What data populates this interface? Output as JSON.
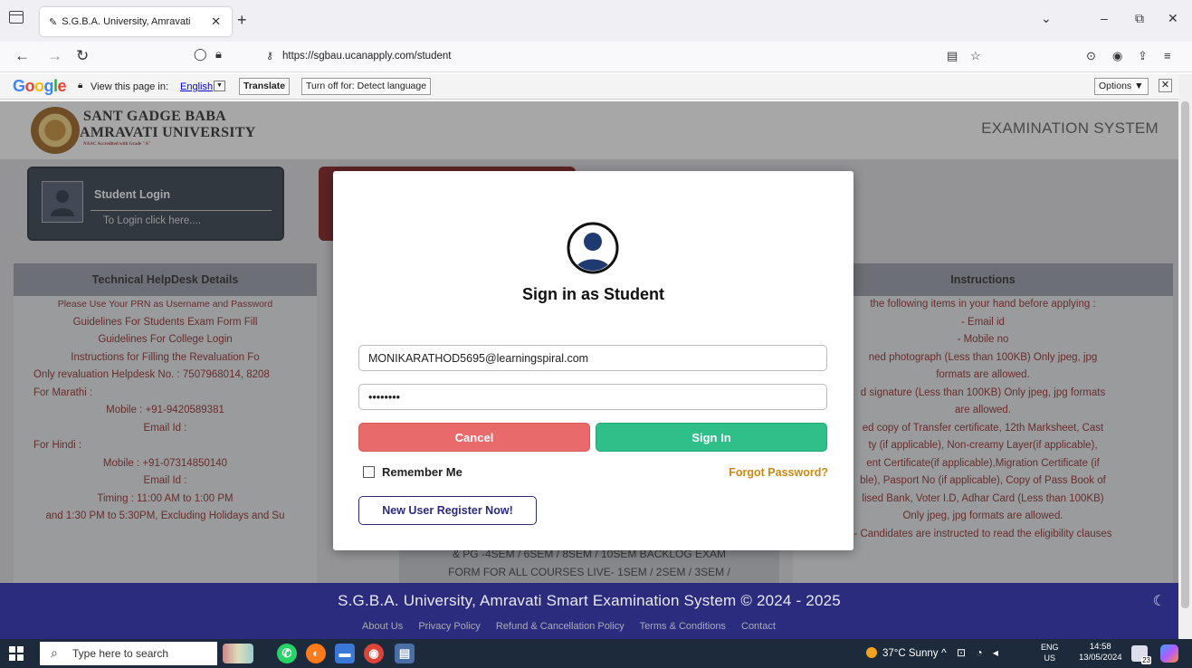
{
  "browser": {
    "tab_title": "S.G.B.A. University, Amravati",
    "url": "https://sgbau.ucanapply.com/student"
  },
  "translate_bar": {
    "google": "Google",
    "view_text": "View this page in:",
    "language": "English",
    "translate_button": "Translate",
    "turn_off_button": "Turn off for: Detect language",
    "options_button": "Options ▼"
  },
  "header": {
    "uni_line1": "SANT GADGE BABA",
    "uni_line2": "AMRAVATI UNIVERSITY",
    "uni_line3": "NAAC Accredited with Grade \"A\"",
    "system_title": "EXAMINATION SYSTEM"
  },
  "student_login": {
    "title": "Student Login",
    "subtitle": "To Login click here...."
  },
  "helpdesk": {
    "heading": "Technical HelpDesk Details",
    "lines": [
      "Please Use Your PRN as Username and Password",
      "Guidelines For Students Exam Form Fill",
      "Guidelines For College Login",
      "Instructions for Filling the Revaluation Fo",
      "Only revaluation Helpdesk No. : 7507968014, 8208",
      "For Marathi :",
      "Mobile : +91-9420589381",
      "Email Id :",
      "For Hindi :",
      "Mobile : +91-07314850140",
      "Email Id :",
      "Timing : 11:00 AM to 1:00 PM",
      "and 1:30 PM to 5:30PM, Excluding Holidays and Su"
    ]
  },
  "instructions": {
    "heading": "Instructions",
    "lines": [
      "the following items in your hand before applying :",
      "- Email id",
      "- Mobile no",
      "ned photograph (Less than 100KB) Only jpeg, jpg",
      "formats are allowed.",
      "d signature (Less than 100KB) Only jpeg, jpg formats",
      "are allowed.",
      "ed copy of Transfer certificate, 12th Marksheet, Cast",
      "ty (if applicable), Non-creamy Layer(if applicable),",
      "ent Certificate(if applicable),Migration Certificate (if",
      "ble), Pasport No (if applicable), Copy of Pass Book of",
      "lised Bank, Voter I.D, Adhar Card (Less than 100KB)",
      "Only jpeg, jpg formats are allowed.",
      "- Candidates are instructed to read the eligibility clauses"
    ]
  },
  "mid_note": {
    "line1": "& PG -4SEM / 6SEM / 8SEM / 10SEM BACKLOG EXAM",
    "line2": "FORM FOR ALL COURSES LIVE- 1SEM / 2SEM / 3SEM /"
  },
  "modal": {
    "title": "Sign in as Student",
    "email_value": "MONIKARATHOD5695@learningspiral.com",
    "password_value": "••••••••",
    "cancel_label": "Cancel",
    "signin_label": "Sign In",
    "remember_label": "Remember Me",
    "forgot_label": "Forgot Password?",
    "register_label": "New User Register Now!"
  },
  "footer": {
    "title": "S.G.B.A. University, Amravati Smart Examination System © 2024 - 2025",
    "links": [
      "About Us",
      "Privacy Policy",
      "Refund & Cancellation Policy",
      "Terms & Conditions",
      "Contact"
    ]
  },
  "taskbar": {
    "search_placeholder": "Type here to search",
    "weather": "37°C  Sunny",
    "lang_top": "ENG",
    "lang_bottom": "US",
    "time": "14:58",
    "date": "13/05/2024",
    "notif_count": "23"
  },
  "colors": {
    "footer_bg": "#2c2c7e",
    "cancel": "#e86a6a",
    "signin": "#2fbf88",
    "forgot": "#c98a12"
  }
}
